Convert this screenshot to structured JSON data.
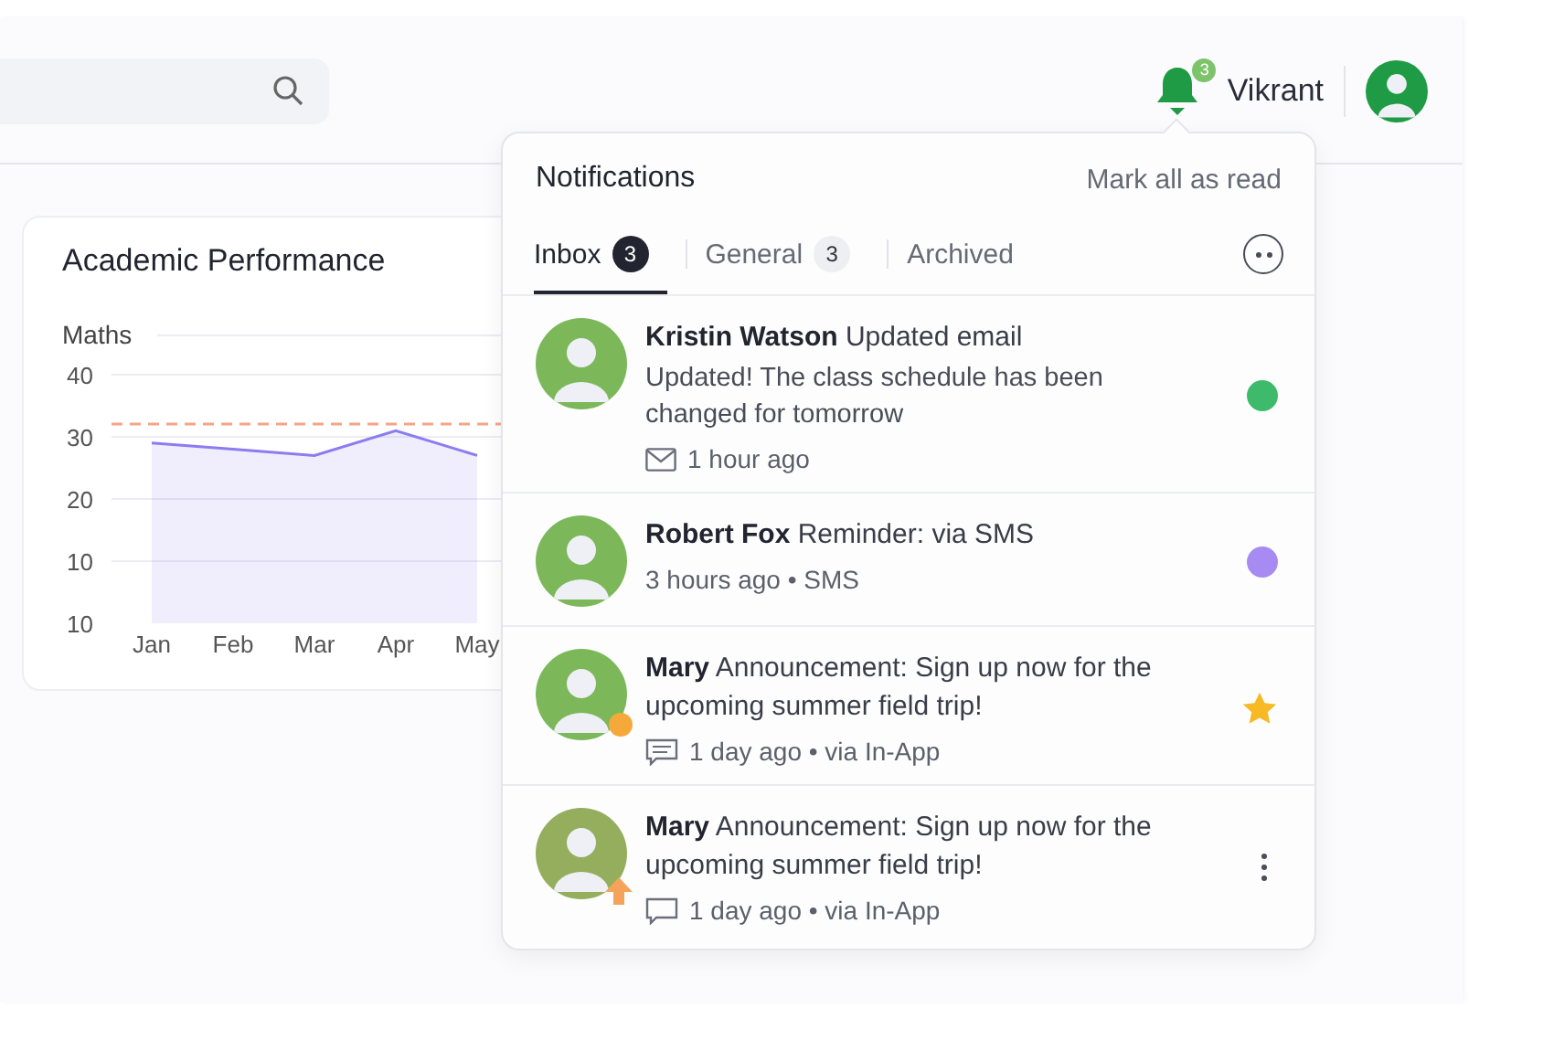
{
  "header": {
    "notification_count": "3",
    "user": {
      "name": "Vikrant"
    }
  },
  "performance_card": {
    "title": "Academic Performance",
    "axis_floor_label": "10",
    "chart_data": {
      "type": "area",
      "categories": [
        "Jan",
        "Feb",
        "Mar",
        "Apr",
        "May"
      ],
      "series": [
        {
          "name": "Maths",
          "color": "#8b7cf0",
          "values": [
            29,
            28,
            27,
            31,
            27
          ]
        }
      ],
      "ylim": [
        0,
        40
      ],
      "yticks": [
        10,
        20,
        30,
        40
      ],
      "grid": true
    }
  },
  "notifications": {
    "title": "Notifications",
    "mark_all": "Mark all as read",
    "tabs": [
      {
        "label": "Inbox",
        "count": "3",
        "selected": true
      },
      {
        "label": "General",
        "count": "3",
        "selected": false
      },
      {
        "label": "Archived",
        "selected": false
      }
    ],
    "items": [
      {
        "headline": "**Kristin Watson** Updated email",
        "message": "Updated! The class schedule has been changed for tomorrow",
        "meta": {
          "kind": "mail",
          "text": "1 hour ago"
        },
        "trailing": {
          "kind": "dot",
          "color": "#3dbb6a"
        }
      },
      {
        "headline": "**Robert Fox** Reminder: via SMS",
        "meta": {
          "kind": "plain",
          "text": "3 hours ago • SMS"
        },
        "trailing": {
          "kind": "dot",
          "color": "#a78bf2"
        }
      },
      {
        "headline": "**Mary** Announcement: Sign up now for the upcoming summer field trip!",
        "meta": {
          "kind": "chat",
          "text": "1 day ago • via In-App"
        },
        "avatar_badge": {
          "kind": "dot"
        },
        "trailing": {
          "kind": "star"
        }
      },
      {
        "headline": "**Mary** Announcement: Sign up now for the upcoming summer field trip!",
        "meta": {
          "kind": "comment",
          "text": "1 day ago • via In-App"
        },
        "avatar_badge": {
          "kind": "arrow"
        },
        "trailing": {
          "kind": "menu"
        }
      }
    ]
  }
}
